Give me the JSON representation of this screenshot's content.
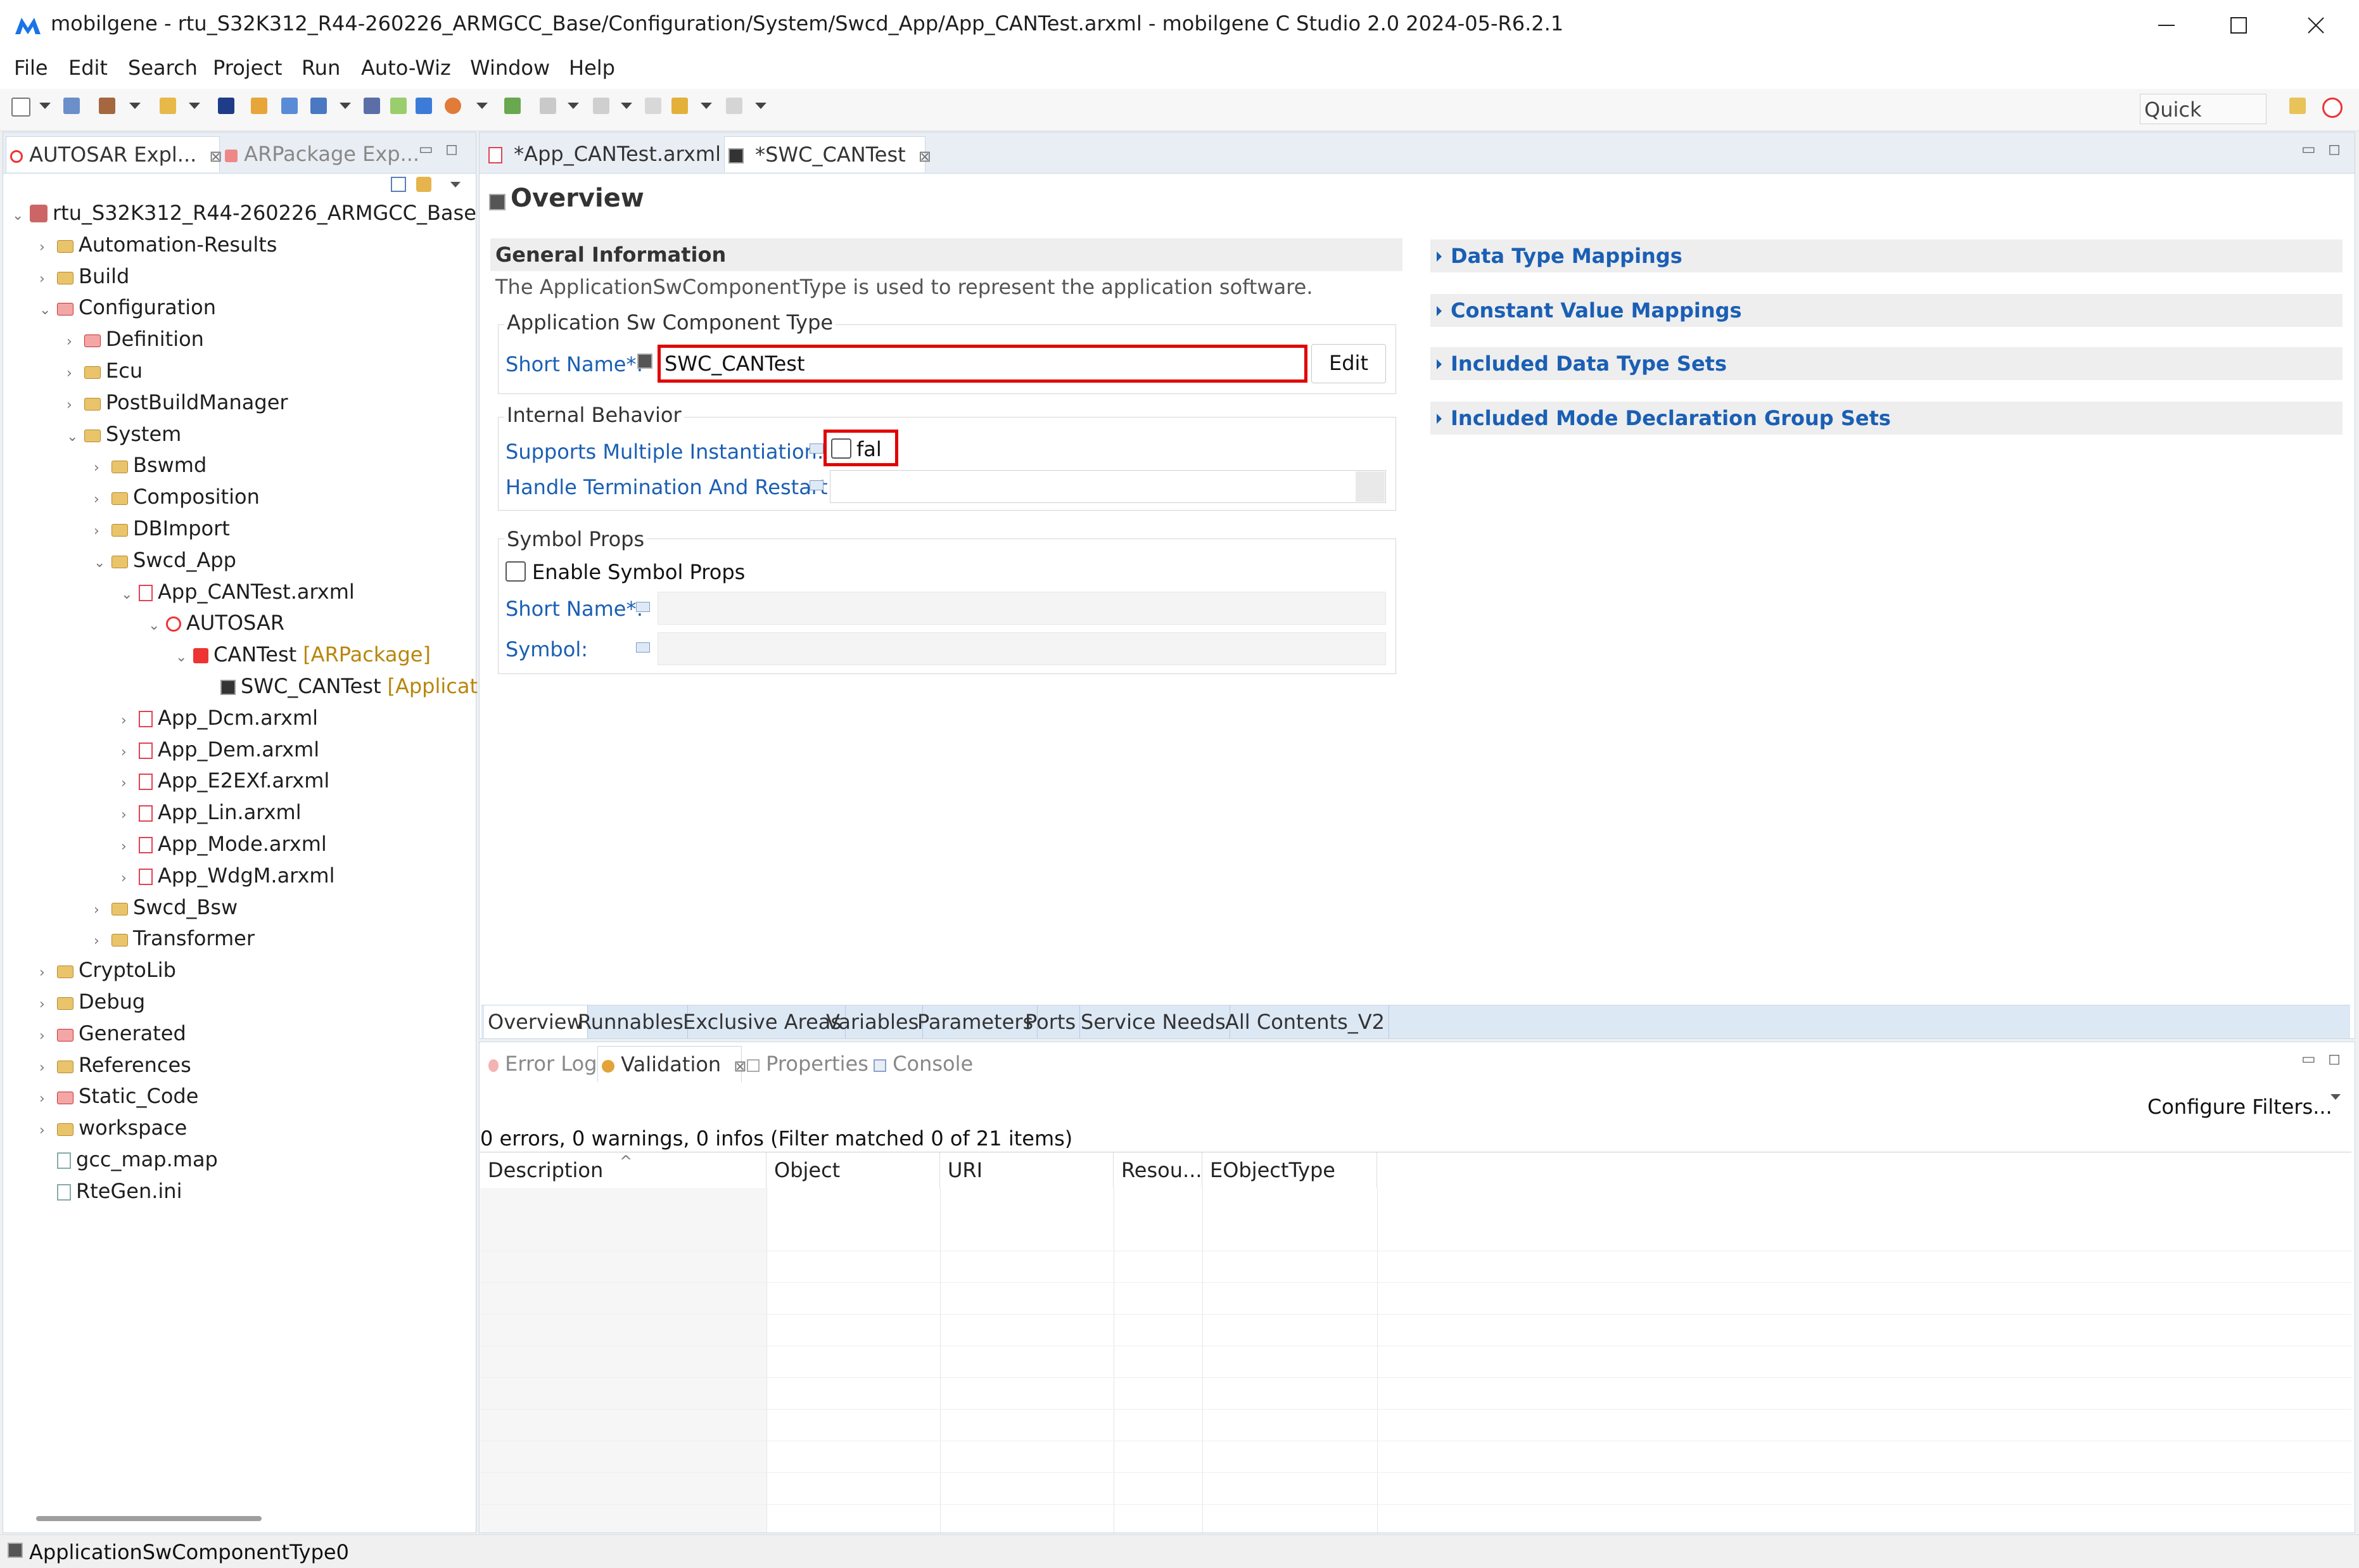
{
  "window": {
    "title": "mobilgene - rtu_S32K312_R44-260226_ARMGCC_Base/Configuration/System/Swcd_App/App_CANTest.arxml - mobilgene C Studio 2.0 2024-05-R6.2.1",
    "minimize_icon": "minimize-icon",
    "maximize_icon": "maximize-icon",
    "close_icon": "close-icon"
  },
  "menu": [
    "File",
    "Edit",
    "Search",
    "Project",
    "Run",
    "Auto-Wiz",
    "Window",
    "Help"
  ],
  "toolbar": {
    "quick_access": "Quick Access"
  },
  "left_panel": {
    "tabs": [
      {
        "label": "AUTOSAR Expl...",
        "close": "⊠"
      },
      {
        "label": "ARPackage Exp..."
      }
    ],
    "tree": [
      {
        "label": "rtu_S32K312_R44-260226_ARMGCC_Base",
        "twisty": "⌄",
        "icon": "project"
      },
      {
        "label": "Automation-Results",
        "twisty": "›",
        "icon": "folder"
      },
      {
        "label": "Build",
        "twisty": "›",
        "icon": "folder"
      },
      {
        "label": "Configuration",
        "twisty": "⌄",
        "icon": "folder-red"
      },
      {
        "label": "Definition",
        "twisty": "›",
        "icon": "folder-red"
      },
      {
        "label": "Ecu",
        "twisty": "›",
        "icon": "folder"
      },
      {
        "label": "PostBuildManager",
        "twisty": "›",
        "icon": "folder"
      },
      {
        "label": "System",
        "twisty": "⌄",
        "icon": "folder"
      },
      {
        "label": "Bswmd",
        "twisty": "›",
        "icon": "folder"
      },
      {
        "label": "Composition",
        "twisty": "›",
        "icon": "folder"
      },
      {
        "label": "DBImport",
        "twisty": "›",
        "icon": "folder"
      },
      {
        "label": "Swcd_App",
        "twisty": "⌄",
        "icon": "folder"
      },
      {
        "label": "App_CANTest.arxml",
        "twisty": "⌄",
        "icon": "arxml"
      },
      {
        "label": "AUTOSAR",
        "twisty": "⌄",
        "icon": "autosar"
      },
      {
        "label": "CANTest",
        "tag": "[ARPackage]",
        "twisty": "⌄",
        "icon": "package"
      },
      {
        "label": "SWC_CANTest",
        "tag": "[Applicat",
        "twisty": "",
        "icon": "component"
      },
      {
        "label": "App_Dcm.arxml",
        "twisty": "›",
        "icon": "arxml"
      },
      {
        "label": "App_Dem.arxml",
        "twisty": "›",
        "icon": "arxml"
      },
      {
        "label": "App_E2EXf.arxml",
        "twisty": "›",
        "icon": "arxml"
      },
      {
        "label": "App_Lin.arxml",
        "twisty": "›",
        "icon": "arxml"
      },
      {
        "label": "App_Mode.arxml",
        "twisty": "›",
        "icon": "arxml"
      },
      {
        "label": "App_WdgM.arxml",
        "twisty": "›",
        "icon": "arxml"
      },
      {
        "label": "Swcd_Bsw",
        "twisty": "›",
        "icon": "folder"
      },
      {
        "label": "Transformer",
        "twisty": "›",
        "icon": "folder"
      },
      {
        "label": "CryptoLib",
        "twisty": "›",
        "icon": "folder"
      },
      {
        "label": "Debug",
        "twisty": "›",
        "icon": "folder"
      },
      {
        "label": "Generated",
        "twisty": "›",
        "icon": "folder-red"
      },
      {
        "label": "References",
        "twisty": "›",
        "icon": "folder"
      },
      {
        "label": "Static_Code",
        "twisty": "›",
        "icon": "folder-red"
      },
      {
        "label": "workspace",
        "twisty": "›",
        "icon": "folder"
      },
      {
        "label": "gcc_map.map",
        "twisty": "",
        "icon": "file"
      },
      {
        "label": "RteGen.ini",
        "twisty": "",
        "icon": "file"
      }
    ]
  },
  "editor": {
    "tabs": [
      {
        "label": "*App_CANTest.arxml"
      },
      {
        "label": "*SWC_CANTest",
        "close": "⊠"
      }
    ],
    "overview_title": "Overview",
    "general": {
      "heading": "General Information",
      "description": "The ApplicationSwComponentType is used to represent the application software."
    },
    "app_group": {
      "title": "Application Sw Component Type",
      "short_name_label": "Short Name*:",
      "short_name_value": "SWC_CANTest",
      "edit_label": "Edit"
    },
    "internal_behavior": {
      "title": "Internal Behavior",
      "multi_inst_label": "Supports Multiple Instantiation:",
      "multi_inst_value": "fal",
      "handle_term_label": "Handle Termination And Restart:"
    },
    "symbol_props": {
      "title": "Symbol Props",
      "enable_label": "Enable Symbol Props",
      "short_name_label": "Short Name*:",
      "symbol_label": "Symbol:"
    },
    "right_sections": [
      "Data Type Mappings",
      "Constant Value Mappings",
      "Included Data Type Sets",
      "Included Mode Declaration Group Sets"
    ],
    "bottom_tabs": [
      "Overview",
      "Runnables",
      "Exclusive Areas",
      "Variables",
      "Parameters",
      "Ports",
      "Service Needs",
      "All Contents_V2"
    ]
  },
  "bottom_panel": {
    "tabs": [
      {
        "label": "Error Log"
      },
      {
        "label": "Validation",
        "close": "⊠"
      },
      {
        "label": "Properties"
      },
      {
        "label": "Console"
      }
    ],
    "summary": "0 errors, 0 warnings, 0 infos (Filter matched 0 of 21 items)",
    "configure_filters": "Configure Filters...",
    "columns": [
      "Description",
      "Object",
      "URI",
      "Resou...",
      "EObjectType"
    ]
  },
  "status": {
    "text": "ApplicationSwComponentType0"
  },
  "colors": {
    "accent": "#1a5fb4",
    "highlight": "#e00000",
    "tag": "#b8860b"
  }
}
